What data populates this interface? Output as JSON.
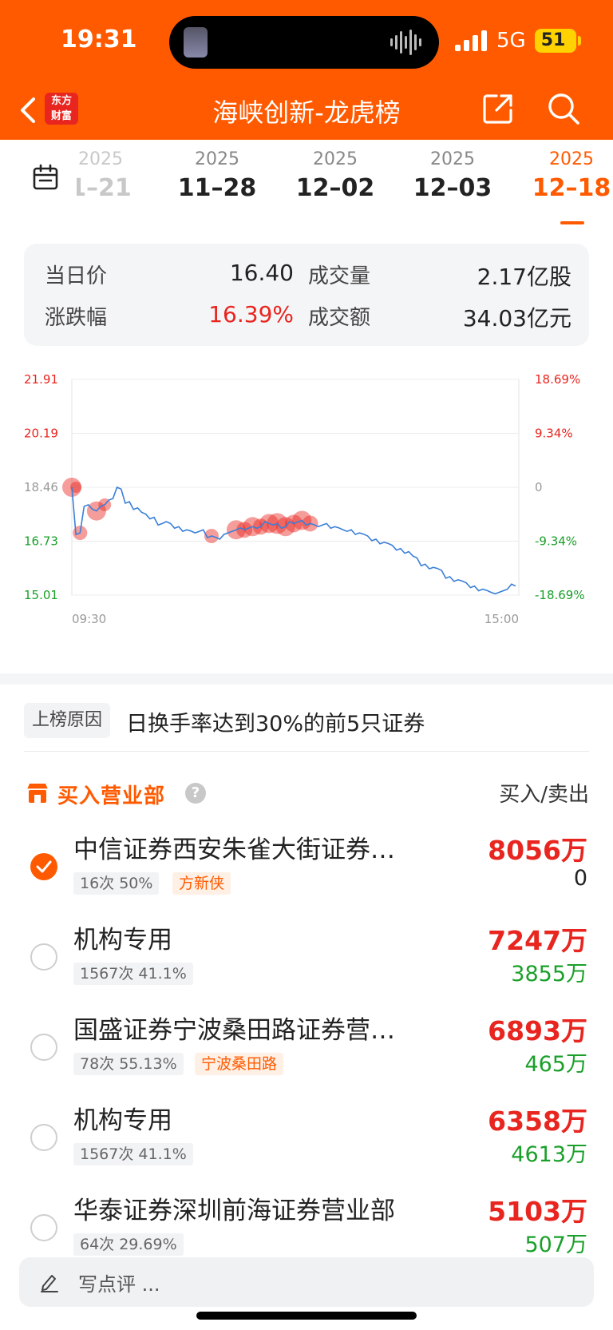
{
  "status_bar": {
    "time": "19:31",
    "network": "5G",
    "battery": "51"
  },
  "nav": {
    "title": "海峡创新-龙虎榜",
    "logo_line1": "东方",
    "logo_line2": "财富"
  },
  "dates": [
    {
      "year": "2025",
      "md": "1–21",
      "state": "faded"
    },
    {
      "year": "2025",
      "md": "11–28",
      "state": "normal"
    },
    {
      "year": "2025",
      "md": "12–02",
      "state": "normal"
    },
    {
      "year": "2025",
      "md": "12–03",
      "state": "normal"
    },
    {
      "year": "2025",
      "md": "12–18",
      "state": "active"
    }
  ],
  "stats": {
    "price_label": "当日价",
    "price_value": "16.40",
    "volume_label": "成交量",
    "volume_value": "2.17亿股",
    "change_label": "涨跌幅",
    "change_value": "16.39%",
    "amount_label": "成交额",
    "amount_value": "34.03亿元"
  },
  "chart_data": {
    "type": "line",
    "y_left_ticks": [
      "21.91",
      "20.19",
      "18.46",
      "16.73",
      "15.01"
    ],
    "y_right_ticks": [
      "18.69%",
      "9.34%",
      "0",
      "-9.34%",
      "-18.69%"
    ],
    "x_ticks": [
      "09:30",
      "15:00"
    ],
    "ylim": [
      15.01,
      21.91
    ],
    "series": [
      {
        "values": [
          18.46,
          17.0,
          17.9,
          17.7,
          17.9,
          18.1,
          18.4,
          18.0,
          17.8,
          17.6,
          17.5,
          17.3,
          17.3,
          17.2,
          17.1,
          17.0,
          17.1,
          16.9,
          16.8,
          17.0,
          17.1,
          17.1,
          17.2,
          17.2,
          17.3,
          17.3,
          17.2,
          17.3,
          17.4,
          17.3,
          17.2,
          17.3,
          17.2,
          17.1,
          17.1,
          17.0,
          16.9,
          16.8,
          16.7,
          16.6,
          16.5,
          16.4,
          16.2,
          16.0,
          15.9,
          15.8,
          15.6,
          15.5,
          15.4,
          15.3,
          15.2,
          15.1,
          15.1,
          15.2,
          15.3
        ]
      }
    ],
    "markers": 16,
    "grid": true
  },
  "reason": {
    "tag": "上榜原因",
    "text": "日换手率达到30%的前5只证券"
  },
  "section": {
    "title": "买入营业部",
    "help": "?",
    "right_label": "买入/卖出"
  },
  "rows": [
    {
      "name": "中信证券西安朱雀大街证券…",
      "meta": "16次 50%",
      "tag": "方新侠",
      "buy": "8056万",
      "sell": "0",
      "checked": true
    },
    {
      "name": "机构专用",
      "meta": "1567次 41.1%",
      "tag": "",
      "buy": "7247万",
      "sell": "3855万",
      "checked": false
    },
    {
      "name": "国盛证券宁波桑田路证券营…",
      "meta": "78次 55.13%",
      "tag": "宁波桑田路",
      "buy": "6893万",
      "sell": "465万",
      "checked": false
    },
    {
      "name": "机构专用",
      "meta": "1567次 41.1%",
      "tag": "",
      "buy": "6358万",
      "sell": "4613万",
      "checked": false
    },
    {
      "name": "华泰证券深圳前海证券营业部",
      "meta": "64次 29.69%",
      "tag": "",
      "buy": "5103万",
      "sell": "507万",
      "checked": false
    }
  ],
  "comment": {
    "placeholder": "写点评 ..."
  }
}
